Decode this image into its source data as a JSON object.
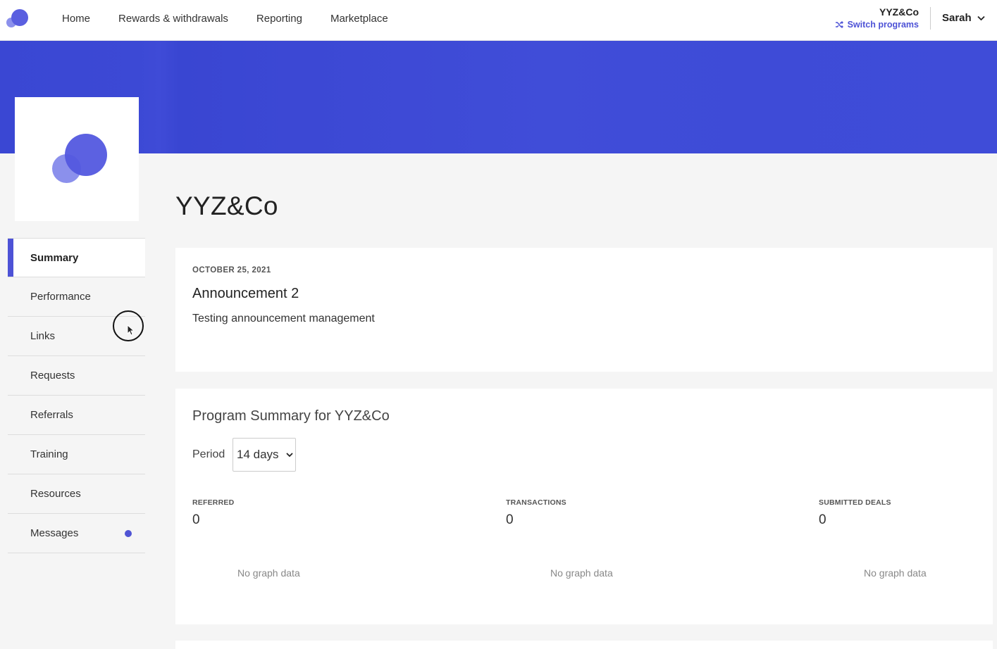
{
  "nav": {
    "items": [
      "Home",
      "Rewards & withdrawals",
      "Reporting",
      "Marketplace"
    ]
  },
  "program": {
    "name": "YYZ&Co",
    "switch_label": "Switch programs"
  },
  "user": {
    "name": "Sarah"
  },
  "sidebar": {
    "items": [
      {
        "label": "Summary"
      },
      {
        "label": "Performance"
      },
      {
        "label": "Links"
      },
      {
        "label": "Requests"
      },
      {
        "label": "Referrals"
      },
      {
        "label": "Training"
      },
      {
        "label": "Resources"
      },
      {
        "label": "Messages"
      }
    ]
  },
  "main": {
    "title": "YYZ&Co",
    "announcement": {
      "date": "OCTOBER 25, 2021",
      "title": "Announcement 2",
      "body": "Testing announcement management"
    },
    "summary": {
      "title": "Program Summary for YYZ&Co",
      "period_label": "Period",
      "period_value": "14 days",
      "stats": [
        {
          "label": "REFERRED",
          "value": "0",
          "graph": "No graph data"
        },
        {
          "label": "TRANSACTIONS",
          "value": "0",
          "graph": "No graph data"
        },
        {
          "label": "SUBMITTED DEALS",
          "value": "0",
          "graph": "No graph data"
        }
      ]
    }
  },
  "colors": {
    "accent": "#4d52d6",
    "banner": "#3d4ad6"
  }
}
